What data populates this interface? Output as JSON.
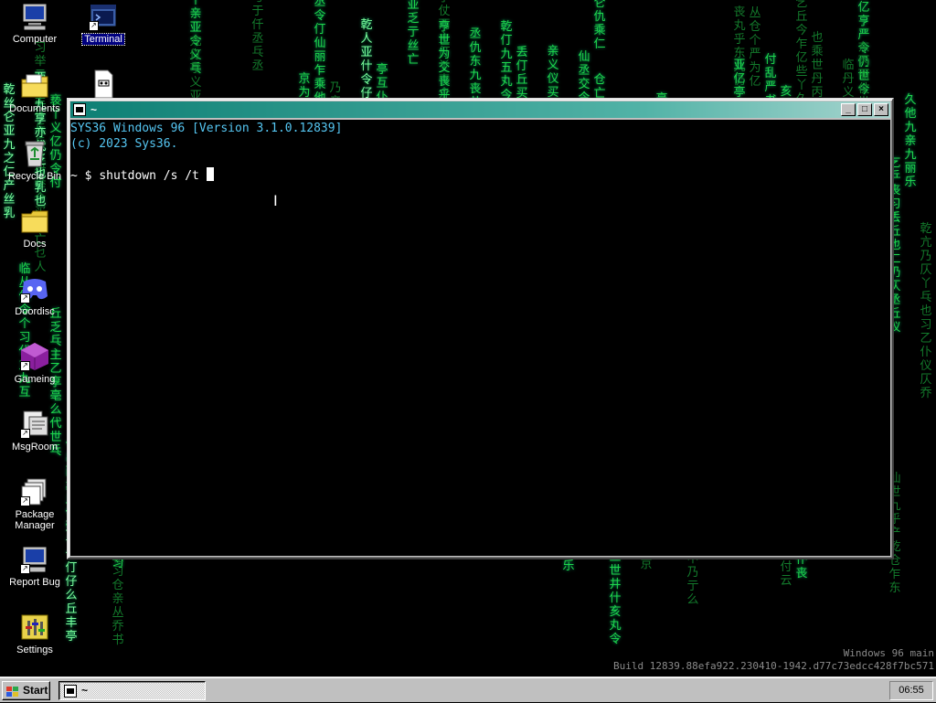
{
  "desktop": {
    "icons": [
      {
        "label": "Computer",
        "icon": "computer-icon"
      },
      {
        "label": "Terminal",
        "icon": "terminal-icon",
        "selected": true
      },
      {
        "label": "Documents",
        "icon": "documents-folder-icon"
      },
      {
        "label": "Recycle Bin",
        "icon": "recycle-bin-icon"
      },
      {
        "label": "Docs",
        "icon": "folder-icon"
      },
      {
        "label": "Doordisc",
        "icon": "doordisc-icon"
      },
      {
        "label": "Gameing",
        "icon": "gameing-icon"
      },
      {
        "label": "MsgRoom",
        "icon": "msgroom-icon"
      },
      {
        "label": "Package Manager",
        "icon": "package-manager-icon"
      },
      {
        "label": "Report Bug",
        "icon": "report-bug-icon"
      },
      {
        "label": "Settings",
        "icon": "settings-icon"
      }
    ],
    "wallpaper": "matrix-rain"
  },
  "window": {
    "title": "~",
    "controls": {
      "minimize": "_",
      "maximize": "□",
      "close": "×"
    },
    "lines": [
      "SYS36 Windows 96 [Version 3.1.0.12839]",
      "(c) 2023 Sys36."
    ],
    "prompt": "~ $",
    "command": "shutdown /s /t"
  },
  "watermark": {
    "line1": "Windows 96 main",
    "line2": "Build 12839.88efa922.230410-1942.d77c73edcc428f7bc571"
  },
  "taskbar": {
    "start_label": "Start",
    "task_title": "~",
    "clock": "06:55"
  },
  "colors": {
    "matrix_green": "#1fd64a",
    "terminal_text": "#55c6f2",
    "titlebar": "#0d7f74",
    "selection": "#000080"
  }
}
